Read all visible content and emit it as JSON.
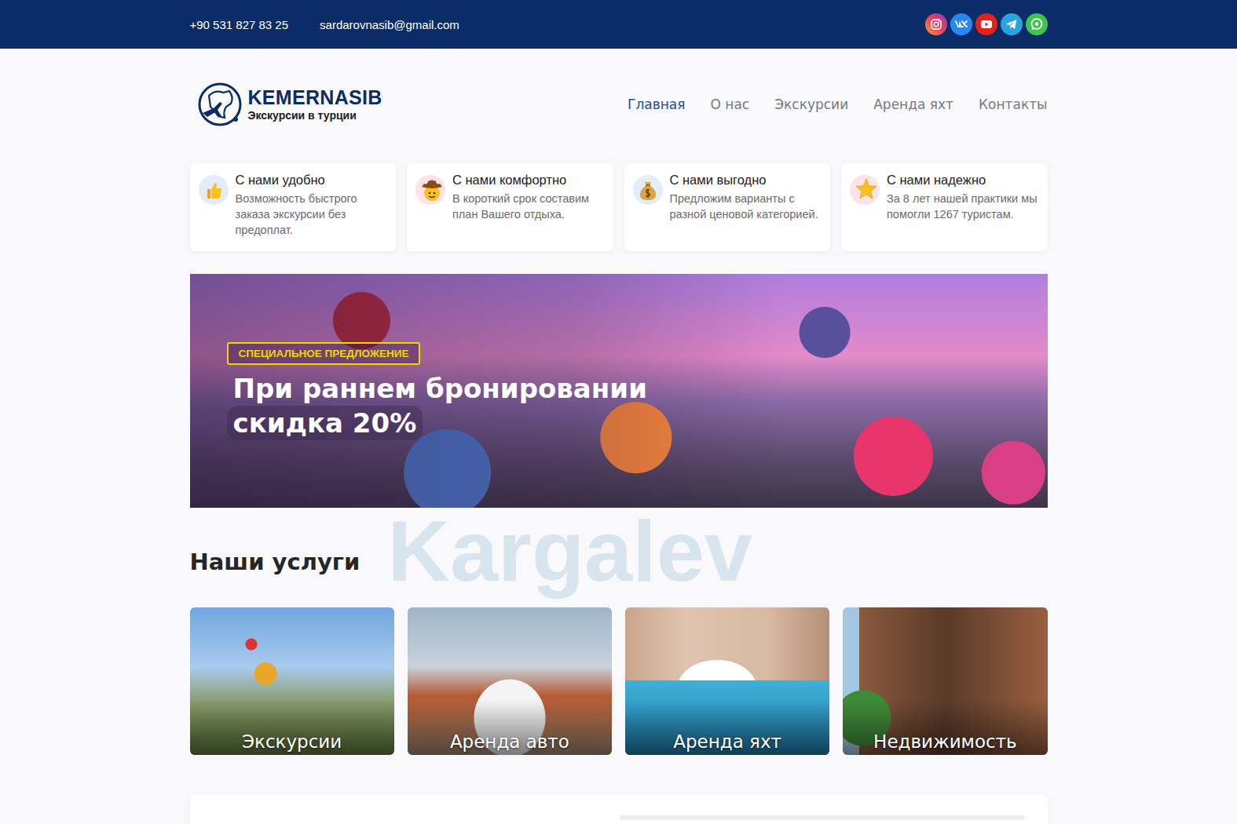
{
  "topbar": {
    "phone": "+90 531 827 83 25",
    "email": "sardarovnasib@gmail.com",
    "socials": [
      {
        "kind": "instagram",
        "color": "#e4405f"
      },
      {
        "kind": "vk",
        "color": "#2787f5"
      },
      {
        "kind": "youtube",
        "color": "#e62117"
      },
      {
        "kind": "telegram",
        "color": "#2aa3e0"
      },
      {
        "kind": "whatsapp",
        "color": "#3fc351"
      }
    ]
  },
  "logo": {
    "title": "KEMERNASIB",
    "subtitle": "Экскурсии в турции"
  },
  "nav": [
    {
      "label": "Главная",
      "selected": true
    },
    {
      "label": "О нас",
      "selected": false
    },
    {
      "label": "Экскурсии",
      "selected": false
    },
    {
      "label": "Аренда яхт",
      "selected": false
    },
    {
      "label": "Контакты",
      "selected": false
    }
  ],
  "features": [
    {
      "kind": "thumb",
      "title": "С нами удобно",
      "text": "Возможность быстрого заказа экскурсии без предоплат."
    },
    {
      "kind": "cowboy",
      "title": "С нами комфортно",
      "text": "В короткий срок составим план Вашего отдыха."
    },
    {
      "kind": "money",
      "title": "С нами выгодно",
      "text": "Предложим варианты с разной ценовой категорией."
    },
    {
      "kind": "star",
      "title": "С нами надежно",
      "text": "За 8 лет нашей практики мы помогли 1267 туристам."
    }
  ],
  "banner": {
    "badge": "СПЕЦИАЛЬНОЕ ПРЕДЛОЖЕНИЕ",
    "title_lines": [
      "При раннем бронировании",
      "скидка 20%"
    ]
  },
  "watermark": "Kargalev",
  "services": {
    "title": "Наши услуги",
    "items": [
      {
        "kind": "balloons",
        "label": "Экскурсии"
      },
      {
        "kind": "car",
        "label": "Аренда авто"
      },
      {
        "kind": "yacht",
        "label": "Аренда яхт"
      },
      {
        "kind": "building",
        "label": "Недвижимость"
      }
    ]
  }
}
